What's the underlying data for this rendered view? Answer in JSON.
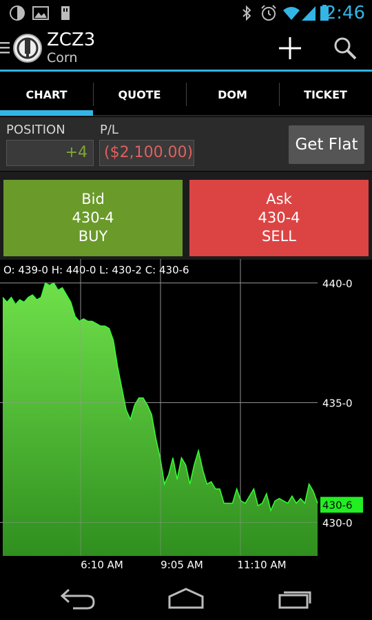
{
  "status_bar": {
    "time": "2:46",
    "icons": [
      "notification-circle-icon",
      "image-icon",
      "sd-card-icon",
      "bluetooth-icon",
      "alarm-icon",
      "wifi-icon",
      "signal-icon",
      "battery-icon"
    ]
  },
  "action_bar": {
    "symbol": "ZCZ3",
    "name": "Corn",
    "icons": [
      "menu-icon",
      "app-logo-icon",
      "add-icon",
      "search-icon"
    ]
  },
  "tabs": [
    {
      "label": "CHART",
      "selected": true
    },
    {
      "label": "QUOTE",
      "selected": false
    },
    {
      "label": "DOM",
      "selected": false
    },
    {
      "label": "TICKET",
      "selected": false
    }
  ],
  "position": {
    "position_label": "POSITION",
    "position_value": "+4",
    "pl_label": "P/L",
    "pl_value": "($2,100.00)",
    "get_flat_label": "Get Flat"
  },
  "bid": {
    "title": "Bid",
    "price": "430-4",
    "action": "BUY",
    "color": "#6a9a2a"
  },
  "ask": {
    "title": "Ask",
    "price": "430-4",
    "action": "SELL",
    "color": "#dc4444"
  },
  "ohlc": "O: 439-0 H: 440-0 L: 430-2 C: 430-6",
  "chart_data": {
    "type": "area",
    "series": [
      {
        "values": [
          439.4,
          439.2,
          439.4,
          439.1,
          439.3,
          439.2,
          439.4,
          439.5,
          439.3,
          439.4,
          440.0,
          439.9,
          440.0,
          439.7,
          439.8,
          439.5,
          439.2,
          438.6,
          438.4,
          438.5,
          438.4,
          438.4,
          438.3,
          438.2,
          438.2,
          438.1,
          437.6,
          436.5,
          435.6,
          434.7,
          434.3,
          434.9,
          435.2,
          435.2,
          434.9,
          434.5,
          433.5,
          432.7,
          431.6,
          432.0,
          432.7,
          431.8,
          432.7,
          432.4,
          431.6,
          432.4,
          433.0,
          432.2,
          431.6,
          431.7,
          431.4,
          431.4,
          430.8,
          430.8,
          430.8,
          431.4,
          430.9,
          430.8,
          431.1,
          431.4,
          430.7,
          430.8,
          431.2,
          430.5,
          430.9,
          431.0,
          430.9,
          430.8,
          431.1,
          430.8,
          431.0,
          430.8,
          431.6,
          431.3,
          430.8
        ]
      }
    ],
    "x_ticks": [
      "6:10 AM",
      "9:05 AM",
      "11:10 AM"
    ],
    "y_ticks": [
      {
        "value": 440.0,
        "label": "440-0"
      },
      {
        "value": 435.0,
        "label": "435-0"
      },
      {
        "value": 430.0,
        "label": "430-0"
      }
    ],
    "ylim": [
      428.6,
      441.0
    ],
    "last_label": "430-6",
    "last_value": 430.75,
    "fill_color": "#55cc33",
    "line_color": "#33ff33",
    "grid": true
  },
  "nav_bar": {
    "icons": [
      "back-icon",
      "home-icon",
      "recents-icon"
    ]
  }
}
